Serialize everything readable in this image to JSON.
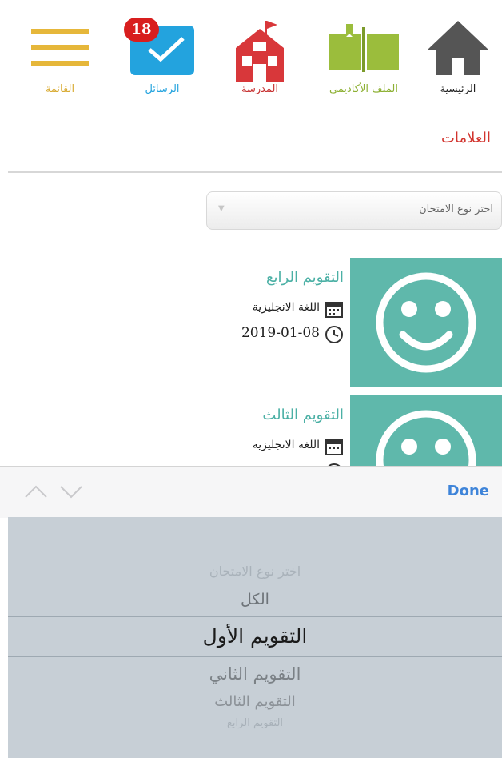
{
  "nav": {
    "home": "الرئيسية",
    "academic_file": "الملف الأكاديمي",
    "school": "المدرسة",
    "messages": "الرسائل",
    "messages_badge": "18",
    "menu": "القائمة"
  },
  "section_title": "العلامات",
  "exam_select": {
    "placeholder": "اختر نوع الامتحان"
  },
  "cards": [
    {
      "title": "التقويم الرابع",
      "subject": "اللغة الانجليزية",
      "date": "2019-01-08"
    },
    {
      "title": "التقويم الثالث",
      "subject": "اللغة الانجليزية"
    }
  ],
  "picker": {
    "done_label": "Done",
    "options": [
      "اختر نوع الامتحان",
      "الكل",
      "التقويم الأول",
      "التقويم الثاني",
      "التقويم الثالث",
      "التقويم الرابع"
    ],
    "selected": "التقويم الأول"
  },
  "colors": {
    "home": "#555555",
    "academic": "#9bbd3c",
    "school": "#d8373a",
    "messages": "#23a3de",
    "menu": "#e6b73a",
    "card_bg": "#5fb8ab",
    "accent_red": "#d2342e",
    "done_blue": "#3e84d9"
  }
}
